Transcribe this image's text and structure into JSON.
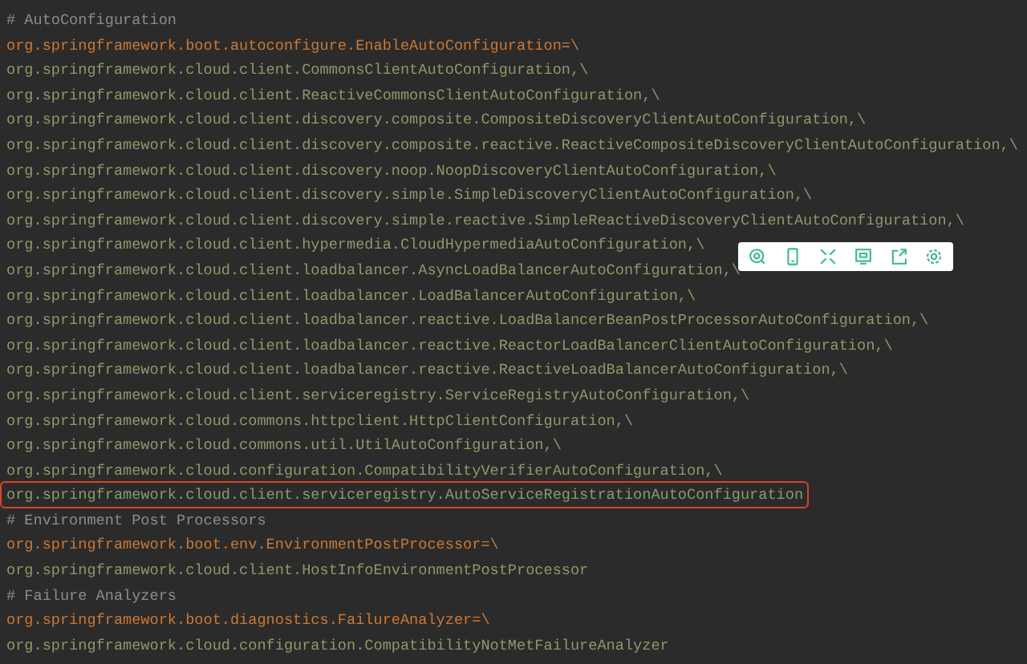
{
  "lines": [
    {
      "kind": "comment",
      "text": "# AutoConfiguration",
      "highlighted": false
    },
    {
      "kind": "key",
      "text": "org.springframework.boot.autoconfigure.EnableAutoConfiguration=\\",
      "highlighted": false
    },
    {
      "kind": "value",
      "text": "org.springframework.cloud.client.CommonsClientAutoConfiguration,\\",
      "highlighted": false
    },
    {
      "kind": "value",
      "text": "org.springframework.cloud.client.ReactiveCommonsClientAutoConfiguration,\\",
      "highlighted": false
    },
    {
      "kind": "value",
      "text": "org.springframework.cloud.client.discovery.composite.CompositeDiscoveryClientAutoConfiguration,\\",
      "highlighted": false
    },
    {
      "kind": "value",
      "text": "org.springframework.cloud.client.discovery.composite.reactive.ReactiveCompositeDiscoveryClientAutoConfiguration,\\",
      "highlighted": false
    },
    {
      "kind": "value",
      "text": "org.springframework.cloud.client.discovery.noop.NoopDiscoveryClientAutoConfiguration,\\",
      "highlighted": false
    },
    {
      "kind": "value",
      "text": "org.springframework.cloud.client.discovery.simple.SimpleDiscoveryClientAutoConfiguration,\\",
      "highlighted": false
    },
    {
      "kind": "value",
      "text": "org.springframework.cloud.client.discovery.simple.reactive.SimpleReactiveDiscoveryClientAutoConfiguration,\\",
      "highlighted": false
    },
    {
      "kind": "value",
      "text": "org.springframework.cloud.client.hypermedia.CloudHypermediaAutoConfiguration,\\",
      "highlighted": false
    },
    {
      "kind": "value",
      "text": "org.springframework.cloud.client.loadbalancer.AsyncLoadBalancerAutoConfiguration,\\",
      "highlighted": false
    },
    {
      "kind": "value",
      "text": "org.springframework.cloud.client.loadbalancer.LoadBalancerAutoConfiguration,\\",
      "highlighted": false
    },
    {
      "kind": "value",
      "text": "org.springframework.cloud.client.loadbalancer.reactive.LoadBalancerBeanPostProcessorAutoConfiguration,\\",
      "highlighted": false
    },
    {
      "kind": "value",
      "text": "org.springframework.cloud.client.loadbalancer.reactive.ReactorLoadBalancerClientAutoConfiguration,\\",
      "highlighted": false
    },
    {
      "kind": "value",
      "text": "org.springframework.cloud.client.loadbalancer.reactive.ReactiveLoadBalancerAutoConfiguration,\\",
      "highlighted": false
    },
    {
      "kind": "value",
      "text": "org.springframework.cloud.client.serviceregistry.ServiceRegistryAutoConfiguration,\\",
      "highlighted": false
    },
    {
      "kind": "value",
      "text": "org.springframework.cloud.commons.httpclient.HttpClientConfiguration,\\",
      "highlighted": false
    },
    {
      "kind": "value",
      "text": "org.springframework.cloud.commons.util.UtilAutoConfiguration,\\",
      "highlighted": false
    },
    {
      "kind": "value",
      "text": "org.springframework.cloud.configuration.CompatibilityVerifierAutoConfiguration,\\",
      "highlighted": false
    },
    {
      "kind": "value",
      "text": "org.springframework.cloud.client.serviceregistry.AutoServiceRegistrationAutoConfiguration",
      "highlighted": true
    },
    {
      "kind": "comment",
      "text": "# Environment Post Processors",
      "highlighted": false
    },
    {
      "kind": "key",
      "text": "org.springframework.boot.env.EnvironmentPostProcessor=\\",
      "highlighted": false
    },
    {
      "kind": "value",
      "text": "org.springframework.cloud.client.HostInfoEnvironmentPostProcessor",
      "highlighted": false
    },
    {
      "kind": "comment",
      "text": "# Failure Analyzers",
      "highlighted": false
    },
    {
      "kind": "key",
      "text": "org.springframework.boot.diagnostics.FailureAnalyzer=\\",
      "highlighted": false
    },
    {
      "kind": "value",
      "text": "org.springframework.cloud.configuration.CompatibilityNotMetFailureAnalyzer",
      "highlighted": false
    }
  ]
}
